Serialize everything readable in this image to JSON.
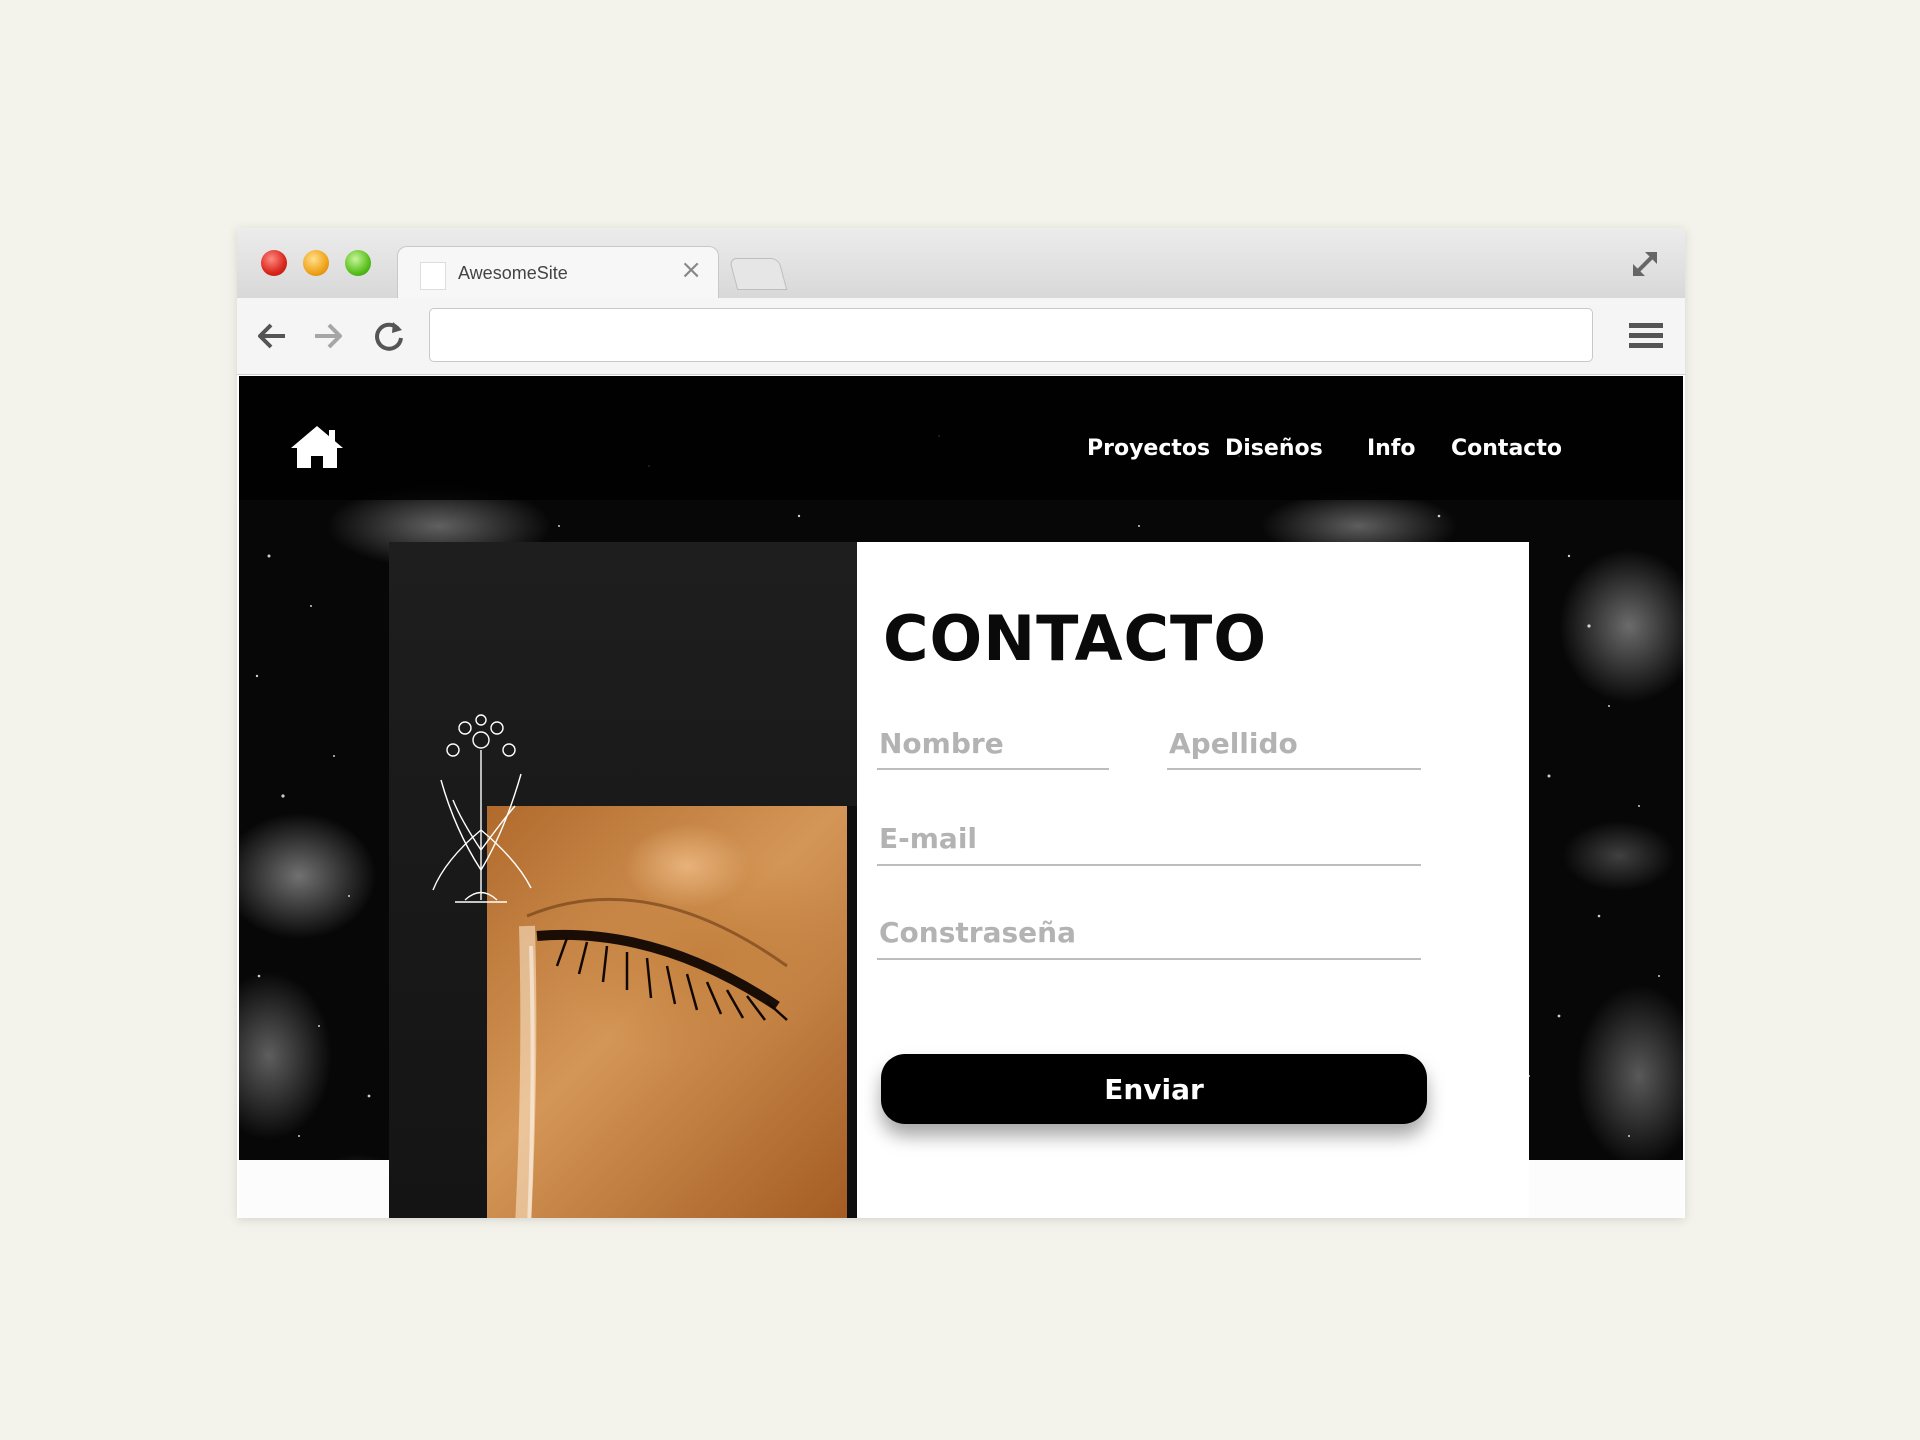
{
  "browser": {
    "tab_title": "AwesomeSite",
    "tab_close": "×",
    "address": ""
  },
  "site": {
    "nav": {
      "items": [
        {
          "label": "Proyectos"
        },
        {
          "label": "Diseños"
        },
        {
          "label": "Info"
        },
        {
          "label": "Contacto"
        }
      ]
    },
    "form": {
      "title": "CONTACTO",
      "first_name_placeholder": "Nombre",
      "last_name_placeholder": "Apellido",
      "email_placeholder": "E-mail",
      "password_placeholder": "Constraseña",
      "submit_label": "Enviar"
    }
  },
  "icons": {
    "home": "home-icon",
    "back": "arrow-left-icon",
    "forward": "arrow-right-icon",
    "reload": "reload-icon",
    "menu": "hamburger-menu-icon",
    "fullscreen": "expand-icon"
  },
  "colors": {
    "page_background": "#f3f3eb",
    "button": "#000000",
    "placeholder": "#b3b3b3"
  }
}
